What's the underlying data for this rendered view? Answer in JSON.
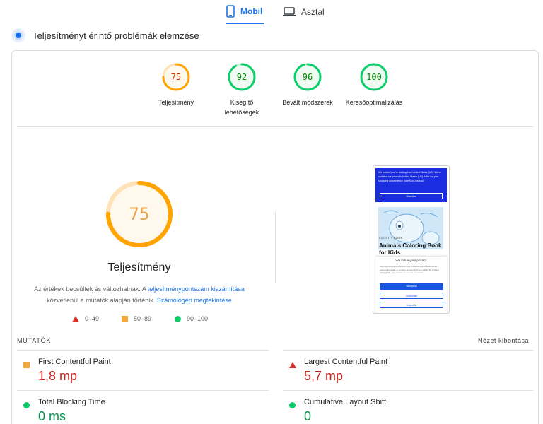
{
  "tabs": {
    "mobile": "Mobil",
    "desktop": "Asztal"
  },
  "header": {
    "title": "Teljesítményt érintő problémák elemzése"
  },
  "scores": [
    {
      "label": "Teljesítmény",
      "value": "75",
      "status": "average"
    },
    {
      "label": "Kisegítő lehetőségek",
      "value": "92",
      "status": "pass"
    },
    {
      "label": "Bevált módszerek",
      "value": "96",
      "status": "pass"
    },
    {
      "label": "Keresőoptimalizálás",
      "value": "100",
      "status": "pass"
    }
  ],
  "performance": {
    "score": "75",
    "score_fraction": 0.75,
    "title": "Teljesítmény",
    "note_prefix": "Az értékek becsültek és változhatnak. A ",
    "note_link1": "teljesítménypontszám kiszámítása",
    "note_middle": "közvetlenül e mutatók alapján történik.",
    "note_link2": "Számológép megtekintése"
  },
  "legend": {
    "fail": "0–49",
    "average": "50–89",
    "pass": "90–100"
  },
  "preview": {
    "banner_text": "We noticed you're visiting from United States (US). We've updated our prices to United States (US) dollar for your shopping convenience. Use Euro instead.",
    "banner_button": "Dismiss",
    "kicker": "ACTIVITY BOOK",
    "headline": "Animals Coloring Book for Kids",
    "modal_title": "We value your privacy",
    "modal_text": "We use cookies to enhance your browsing experience, serve personalized ads or content, and analyze our traffic. By clicking \"Accept All\", you consent to our use of cookies.",
    "accept": "Accept All",
    "customize": "Customize",
    "reject": "Reject All"
  },
  "metrics": {
    "heading": "MUTATÓK",
    "expand": "Nézet kibontása",
    "items": [
      {
        "label": "First Contentful Paint",
        "value": "1,8 mp",
        "status": "average"
      },
      {
        "label": "Largest Contentful Paint",
        "value": "5,7 mp",
        "status": "fail"
      },
      {
        "label": "Total Blocking Time",
        "value": "0 ms",
        "status": "pass"
      },
      {
        "label": "Cumulative Layout Shift",
        "value": "0",
        "status": "pass"
      }
    ]
  },
  "colors": {
    "accent": "#1a73e8",
    "pass": "#0cce6b",
    "average": "#ffa400",
    "fail": "#ff4e42",
    "average_text": "#c5221f",
    "pass_text": "#0d904f"
  },
  "icons": {
    "mobile_tab": "smartphone-icon",
    "desktop_tab": "laptop-icon",
    "header": "performance-dot-icon"
  }
}
